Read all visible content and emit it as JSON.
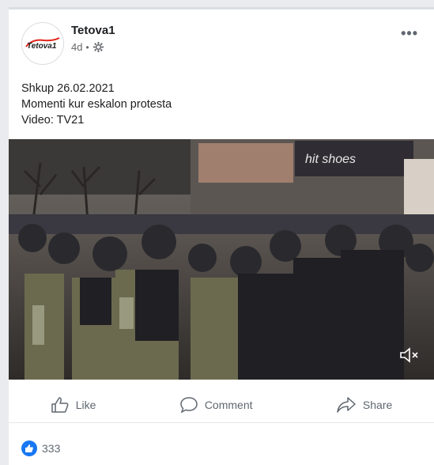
{
  "post": {
    "page_name": "Tetova1",
    "logo_text": "Tetova1",
    "time": "4d",
    "separator": "•",
    "more_label": "•••",
    "lines": [
      "Shkup 26.02.2021",
      "Momenti kur eskalon protesta",
      "Video: TV21"
    ]
  },
  "video": {
    "store_sign": "hit shoes",
    "muted": true
  },
  "actions": {
    "like": "Like",
    "comment": "Comment",
    "share": "Share"
  },
  "reactions": {
    "count": "333"
  },
  "colors": {
    "accent": "#1877f2",
    "logo_red": "#e2231a"
  }
}
